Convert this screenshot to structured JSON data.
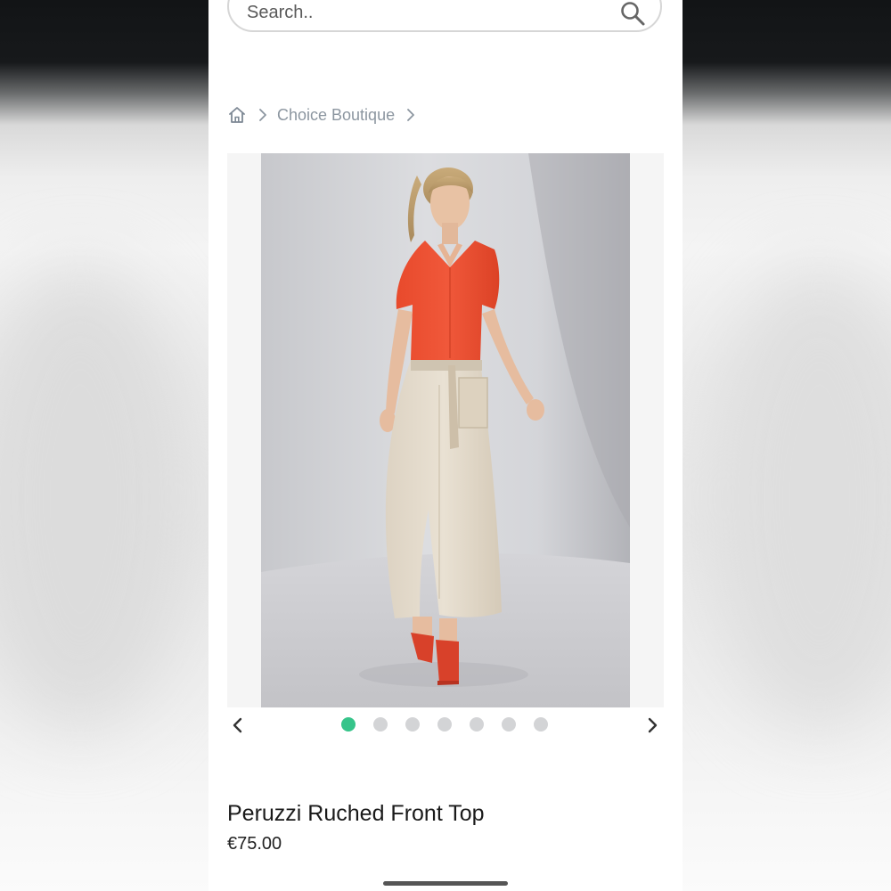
{
  "search": {
    "placeholder": "Search..",
    "icon": "search-icon"
  },
  "breadcrumb": {
    "home_icon": "home-icon",
    "separator_icon": "chevron-right-icon",
    "items": [
      "Choice Boutique"
    ]
  },
  "gallery": {
    "image_count": 7,
    "active_index": 0,
    "prev_icon": "chevron-left-icon",
    "next_icon": "chevron-right-icon",
    "colors": {
      "active_dot": "#36c48a",
      "inactive_dot": "#d3d4d6"
    }
  },
  "product": {
    "title": "Peruzzi Ruched Front Top",
    "price": "€75.00"
  }
}
